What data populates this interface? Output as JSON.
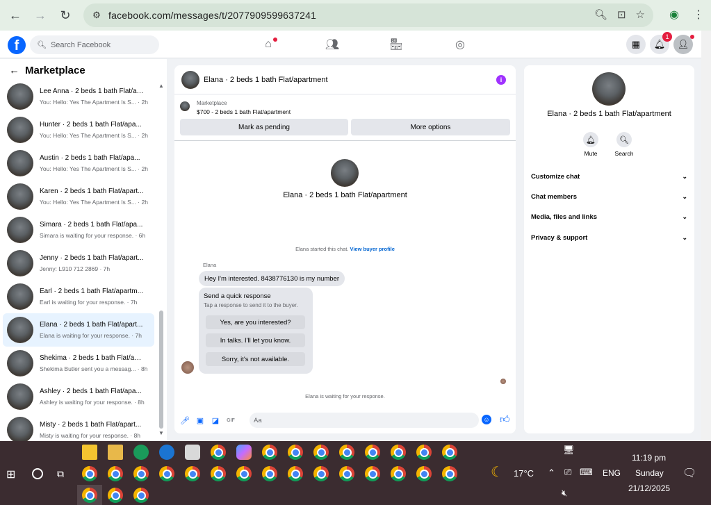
{
  "browser": {
    "url": "facebook.com/messages/t/2077909599637241"
  },
  "fb": {
    "search_placeholder": "Search Facebook",
    "notif_count": "1"
  },
  "sidebar": {
    "title": "Marketplace",
    "items": [
      {
        "name": "Lee Anna · 2 beds 1 bath Flat/apa...",
        "sub": "You: Hello: Yes The Apartment Is S... · 2h"
      },
      {
        "name": "Hunter · 2 beds 1 bath Flat/apa...",
        "sub": "You: Hello: Yes The Apartment Is S... · 2h"
      },
      {
        "name": "Austin · 2 beds 1 bath Flat/apa...",
        "sub": "You: Hello: Yes The Apartment Is S... · 2h"
      },
      {
        "name": "Karen · 2 beds 1 bath Flat/apart...",
        "sub": "You: Hello: Yes The Apartment Is S... · 2h"
      },
      {
        "name": "Simara · 2 beds 1 bath Flat/apa...",
        "sub": "Simara is waiting for your response. · 6h"
      },
      {
        "name": "Jenny · 2 beds 1 bath Flat/apart...",
        "sub": "Jenny: L910 712 2869 · 7h"
      },
      {
        "name": "Earl · 2 beds 1 bath Flat/apartm...",
        "sub": "Earl is waiting for your response. · 7h"
      },
      {
        "name": "Elana · 2 beds 1 bath Flat/apart...",
        "sub": "Elana is waiting for your response. · 7h"
      },
      {
        "name": "Shekima · 2 beds 1 bath Flat/ap...",
        "sub": "Shekima Butler sent you a messag... · 8h"
      },
      {
        "name": "Ashley · 2 beds 1 bath Flat/apa...",
        "sub": "Ashley is waiting for your response. · 8h"
      },
      {
        "name": "Misty · 2 beds 1 bath Flat/apart...",
        "sub": "Misty is waiting for your response. · 8h"
      }
    ]
  },
  "chat": {
    "title": "Elana · 2 beds 1 bath Flat/apartment",
    "marketplace_label": "Marketplace",
    "listing": "$700 - 2 beds 1 bath Flat/apartment",
    "mark_pending": "Mark as pending",
    "more_options": "More options",
    "center_name": "Elana · 2 beds 1 bath Flat/apartment",
    "started_text": "Elana started this chat.",
    "view_profile": "View buyer profile",
    "sender": "Elana",
    "message": "Hey I'm interested. 8438776130 is my number",
    "qr_title": "Send a quick response",
    "qr_sub": "Tap a response to send it to the buyer.",
    "qr_options": [
      "Yes, are you interested?",
      "In talks. I'll let you know.",
      "Sorry, it's not available."
    ],
    "waiting": "Elana is waiting for your response.",
    "composer_placeholder": "Aa"
  },
  "details": {
    "name": "Elana · 2 beds 1 bath Flat/apartment",
    "mute": "Mute",
    "search": "Search",
    "rows": [
      "Customize chat",
      "Chat members",
      "Media, files and links",
      "Privacy & support"
    ]
  },
  "taskbar": {
    "weather": "17°C",
    "lang": "ENG",
    "time": "11:19 pm",
    "day": "Sunday",
    "date": "21/12/2025"
  },
  "colors": {
    "accent": "#0866ff",
    "badge": "#e41e3f",
    "info": "#a033ff",
    "taskbar": "#3b2c30"
  }
}
